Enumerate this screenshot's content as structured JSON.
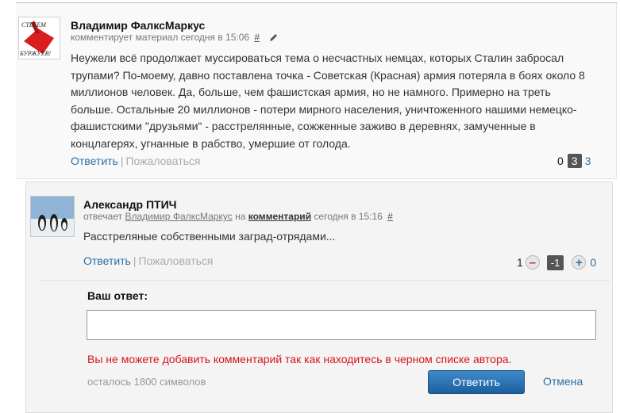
{
  "comment": {
    "author": "Владимир ФалксМаркус",
    "meta_text": "комментирует материал сегодня в 15:06",
    "anchor": "#",
    "avatar_lines": [
      "СТЕБЕМ",
      "БУРЖУЕВ!"
    ],
    "body": "Неужели всё продолжает муссироваться тема о несчастных немцах, которых Сталин забросал трупами? По-моему, давно поставлена точка - Советская (Красная) армия потеряла в боях около 8 миллионов человек. Да, больше, чем фашистская армия, но не намного. Примерно на треть больше. Остальные 20 миллионов - потери мирного населения, уничтоженного нашими немецко-фашистскими \"друзьями\" - расстрелянные, сожженные заживо в деревнях, замученные в концлагерях, угнанные в рабство, умершие от голода.",
    "reply_link": "Ответить",
    "separator": "|",
    "report_link": "Пожаловаться",
    "votes": {
      "down": "0",
      "score": "3",
      "up": "3"
    }
  },
  "reply_comment": {
    "author": "Александр ПТИЧ",
    "meta_prefix": "отвечает",
    "meta_user": "Владимир ФалксМаркус",
    "meta_on": "на",
    "meta_target": "комментарий",
    "meta_time": "сегодня в 15:16",
    "anchor": "#",
    "body": "Расстреляные собственными заград-отрядами...",
    "reply_link": "Ответить",
    "separator": "|",
    "report_link": "Пожаловаться",
    "votes": {
      "minus_count": "1",
      "minus_symbol": "–",
      "score": "-1",
      "plus_symbol": "+",
      "plus_count": "0"
    }
  },
  "reply_form": {
    "label": "Ваш ответ:",
    "value": "",
    "error": "Вы не можете добавить комментарий так как находитесь в черном списке автора.",
    "remaining": "осталось 1800 символов",
    "submit": "Ответить",
    "cancel": "Отмена"
  },
  "colors": {
    "link": "#2c6ea4",
    "error": "#d8141b",
    "button": "#2a6fb0",
    "score_badge": "#555555"
  }
}
